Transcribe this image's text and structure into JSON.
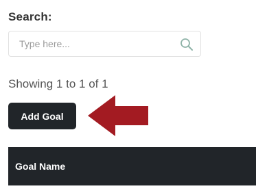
{
  "search": {
    "label": "Search:",
    "placeholder": "Type here...",
    "value": "",
    "icon": "search-icon"
  },
  "pagination": {
    "showing_text": "Showing 1 to 1 of 1"
  },
  "toolbar": {
    "add_goal_label": "Add Goal"
  },
  "annotation": {
    "icon": "arrow-left-icon",
    "color": "#a31b22"
  },
  "table": {
    "columns": [
      "Goal Name"
    ]
  },
  "colors": {
    "dark": "#212529",
    "text": "#333333",
    "muted": "#9a9a9a",
    "border": "#e1e1e1"
  }
}
